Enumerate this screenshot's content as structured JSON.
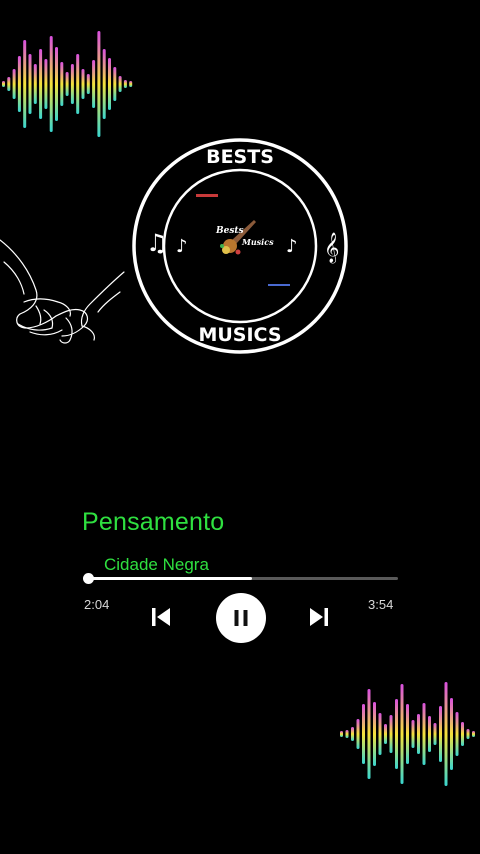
{
  "logo": {
    "top_text": "BESTS",
    "bottom_text": "MUSICS",
    "inner_line1": "Bests",
    "inner_line2": "Musics"
  },
  "player": {
    "title": "Pensamento",
    "artist": "Cidade Negra",
    "elapsed": "2:04",
    "total": "3:54",
    "progress_fraction": 0.53
  },
  "icons": {
    "prev": "skip-previous-icon",
    "pause": "pause-icon",
    "next": "skip-next-icon"
  },
  "colors": {
    "background": "#000000",
    "accent_green": "#2fe040",
    "wave_top": "#d94fe0",
    "wave_mid": "#f4e23a",
    "wave_bottom": "#39d6d0"
  }
}
